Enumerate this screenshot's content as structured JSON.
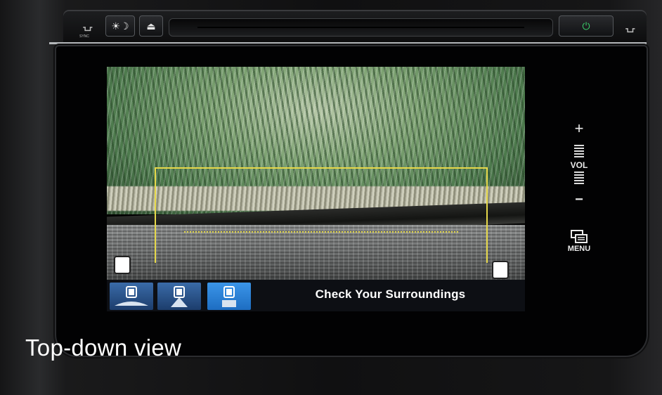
{
  "head_unit": {
    "brightness_icon_glyph": "☀☽",
    "eject_icon_glyph": "⏏",
    "power_icon_glyph": "⏻",
    "power_color": "#3ad06a",
    "sync_label": "SYNC"
  },
  "camera": {
    "active_view_index": 2,
    "views": [
      {
        "name": "wide-view"
      },
      {
        "name": "normal-view"
      },
      {
        "name": "top-down-view"
      }
    ],
    "message": "Check Your Surroundings",
    "guide_color": "#e6d84a"
  },
  "side_controls": {
    "plus": "+",
    "vol_label": "VOL",
    "minus": "−",
    "menu_label": "MENU"
  },
  "caption": "Top-down view"
}
